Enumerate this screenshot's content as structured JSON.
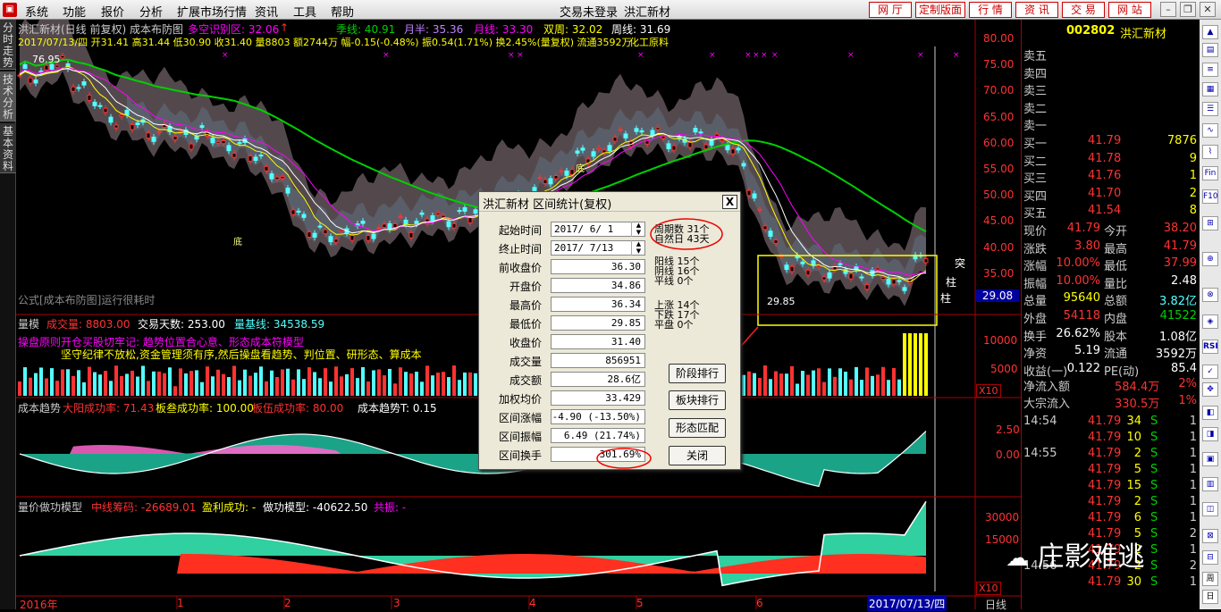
{
  "menu": {
    "items": [
      "系统",
      "功能",
      "报价",
      "分析",
      "扩展市场行情",
      "资讯",
      "工具",
      "帮助"
    ],
    "status": "交易未登录",
    "stock_name": "洪汇新材",
    "buttons": [
      "网 厅",
      "定制版面",
      "行 情",
      "资 讯",
      "交 易",
      "网 站"
    ]
  },
  "left_tabs": [
    "分时走势",
    "技术分析",
    "基本资料"
  ],
  "main_chart": {
    "header1": {
      "title": "洪汇新材(日线 前复权) 成本布防图",
      "zone_label": "多空识别区: 32.06",
      "season": "季线: 40.91",
      "half": "月半: 35.36",
      "month": "月线: 33.30",
      "double_week": "双周: 32.02",
      "week": "周线: 31.69"
    },
    "header2": {
      "text": "2017/07/13/四 开31.41 高31.44 低30.90 收31.40 量8803 额2744万 幅-0.15(-0.48%) 振0.54(1.71%) 换2.45%(量复权) 流通3592万",
      "industry": "化工原料"
    },
    "high_label": "76.95",
    "low_label": "29.85",
    "formula_note": "公式[成本布防图]运行很耗时",
    "y_ticks": [
      "80.00",
      "75.00",
      "70.00",
      "65.00",
      "60.00",
      "55.00",
      "50.00",
      "45.00",
      "40.00",
      "35.00"
    ],
    "last_price_tag": "29.08",
    "side_labels": [
      "突",
      "柱",
      "柱"
    ],
    "low_markers": [
      "底",
      "底"
    ]
  },
  "vol_panel": {
    "label": "量模",
    "vol": "成交量: 8803.00",
    "days": "交易天数: 253.00",
    "base": "量基线: 34538.59",
    "principle": "操盘原则开仓买股切牢记: 趋势位置合心意、形态成本符模型",
    "principle2": "坚守纪律不放松,资金管理须有序,然后操盘看趋势、判位置、研形态、算成本",
    "y_ticks": [
      "10000",
      "5000"
    ],
    "mult": "X10"
  },
  "trend_panel": {
    "label": "成本趋势",
    "big_sun": "大阳成功率: 71.43",
    "board": "板叁成功率: 100.00",
    "board5": "板伍成功率: 80.00",
    "t": "成本趋势T: 0.15",
    "y_ticks": [
      "2.50",
      "0.00"
    ]
  },
  "model_panel": {
    "label": "量价做功模型",
    "mid": "中线筹码: -26689.01",
    "profit": "盈利成功: -",
    "work": "做功模型: -40622.50",
    "common": "共振: -",
    "y_ticks": [
      "30000",
      "15000"
    ],
    "mult": "X10"
  },
  "x_axis": {
    "labels": [
      "2016年",
      "1",
      "2",
      "3",
      "4",
      "5",
      "6"
    ],
    "date_cursor": "2017/07/13/四",
    "period": "日线"
  },
  "dialog": {
    "title": "洪汇新材 区间统计(复权)",
    "rows": [
      {
        "label": "起始时间",
        "value": "2017/ 6/ 1"
      },
      {
        "label": "终止时间",
        "value": "2017/ 7/13"
      },
      {
        "label": "前收盘价",
        "value": "36.30"
      },
      {
        "label": "开盘价",
        "value": "34.86"
      },
      {
        "label": "最高价",
        "value": "36.34"
      },
      {
        "label": "最低价",
        "value": "29.85"
      },
      {
        "label": "收盘价",
        "value": "31.40"
      },
      {
        "label": "成交量",
        "value": "856951"
      },
      {
        "label": "成交额",
        "value": "28.6亿"
      },
      {
        "label": "加权均价",
        "value": "33.429"
      },
      {
        "label": "区间涨幅",
        "value": "-4.90 (-13.50%)"
      },
      {
        "label": "区间振幅",
        "value": "6.49 (21.74%)"
      },
      {
        "label": "区间换手",
        "value": "301.69%"
      }
    ],
    "stats": {
      "period_days": "周期数 31个",
      "natural_days": "自然日 43天",
      "yang": "阳线 15个",
      "yin": "阴线 16个",
      "flat": "平线 0个",
      "up": "上涨 14个",
      "down": "下跌 17个",
      "level": "平盘 0个"
    },
    "buttons": [
      "阶段排行",
      "板块排行",
      "形态匹配",
      "关闭"
    ],
    "close_x": "X"
  },
  "quote": {
    "code": "002802",
    "name": "洪汇新材",
    "sell": [
      {
        "label": "卖五"
      },
      {
        "label": "卖四"
      },
      {
        "label": "卖三"
      },
      {
        "label": "卖二"
      },
      {
        "label": "卖一"
      }
    ],
    "buy": [
      {
        "label": "买一",
        "price": "41.79",
        "vol": "7876"
      },
      {
        "label": "买二",
        "price": "41.78",
        "vol": "9"
      },
      {
        "label": "买三",
        "price": "41.76",
        "vol": "1"
      },
      {
        "label": "买四",
        "price": "41.70",
        "vol": "2"
      },
      {
        "label": "买五",
        "price": "41.54",
        "vol": "8"
      }
    ],
    "stats": [
      {
        "l1": "现价",
        "v1": "41.79",
        "l2": "今开",
        "v2": "38.20"
      },
      {
        "l1": "涨跌",
        "v1": "3.80",
        "l2": "最高",
        "v2": "41.79"
      },
      {
        "l1": "涨幅",
        "v1": "10.00%",
        "l2": "最低",
        "v2": "37.99"
      },
      {
        "l1": "振幅",
        "v1": "10.00%",
        "l2": "量比",
        "v2": "2.48"
      },
      {
        "l1": "总量",
        "v1": "95640",
        "l2": "总额",
        "v2": "3.82亿"
      },
      {
        "l1": "外盘",
        "v1": "54118",
        "l2": "内盘",
        "v2": "41522"
      },
      {
        "l1": "换手",
        "v1": "26.62%",
        "l2": "股本",
        "v2": "1.08亿"
      },
      {
        "l1": "净资",
        "v1": "5.19",
        "l2": "流通",
        "v2": "3592万"
      },
      {
        "l1": "收益(一)",
        "v1": "0.122",
        "l2": "PE(动)",
        "v2": "85.4"
      }
    ],
    "flows": [
      {
        "label": "净流入额",
        "v": "584.4万",
        "p": "2%"
      },
      {
        "label": "大宗流入",
        "v": "330.5万",
        "p": "1%"
      }
    ],
    "ticks": [
      {
        "t": "14:54",
        "p": "41.79",
        "v": "34",
        "s": "S",
        "n": "1"
      },
      {
        "t": "",
        "p": "41.79",
        "v": "10",
        "s": "S",
        "n": "1"
      },
      {
        "t": "14:55",
        "p": "41.79",
        "v": "2",
        "s": "S",
        "n": "1"
      },
      {
        "t": "",
        "p": "41.79",
        "v": "5",
        "s": "S",
        "n": "1"
      },
      {
        "t": "",
        "p": "41.79",
        "v": "15",
        "s": "S",
        "n": "1"
      },
      {
        "t": "",
        "p": "41.79",
        "v": "2",
        "s": "S",
        "n": "1"
      },
      {
        "t": "",
        "p": "41.79",
        "v": "6",
        "s": "S",
        "n": "1"
      },
      {
        "t": "",
        "p": "41.79",
        "v": "5",
        "s": "S",
        "n": "2"
      },
      {
        "t": "",
        "p": "41.79",
        "v": "2",
        "s": "S",
        "n": "1"
      },
      {
        "t": "14:56",
        "p": "41.79",
        "v": "2",
        "s": "S",
        "n": "2"
      },
      {
        "t": "",
        "p": "41.79",
        "v": "30",
        "s": "S",
        "n": "1"
      }
    ]
  },
  "right_tools": [
    "RSI",
    "Fin",
    "F10",
    "周",
    "日"
  ],
  "watermark": "庄影难逃",
  "colors": {
    "up": "#ff3232",
    "down": "#54ffff",
    "yellow": "#ffff00",
    "purple": "#ff00ff",
    "green": "#00d000"
  }
}
